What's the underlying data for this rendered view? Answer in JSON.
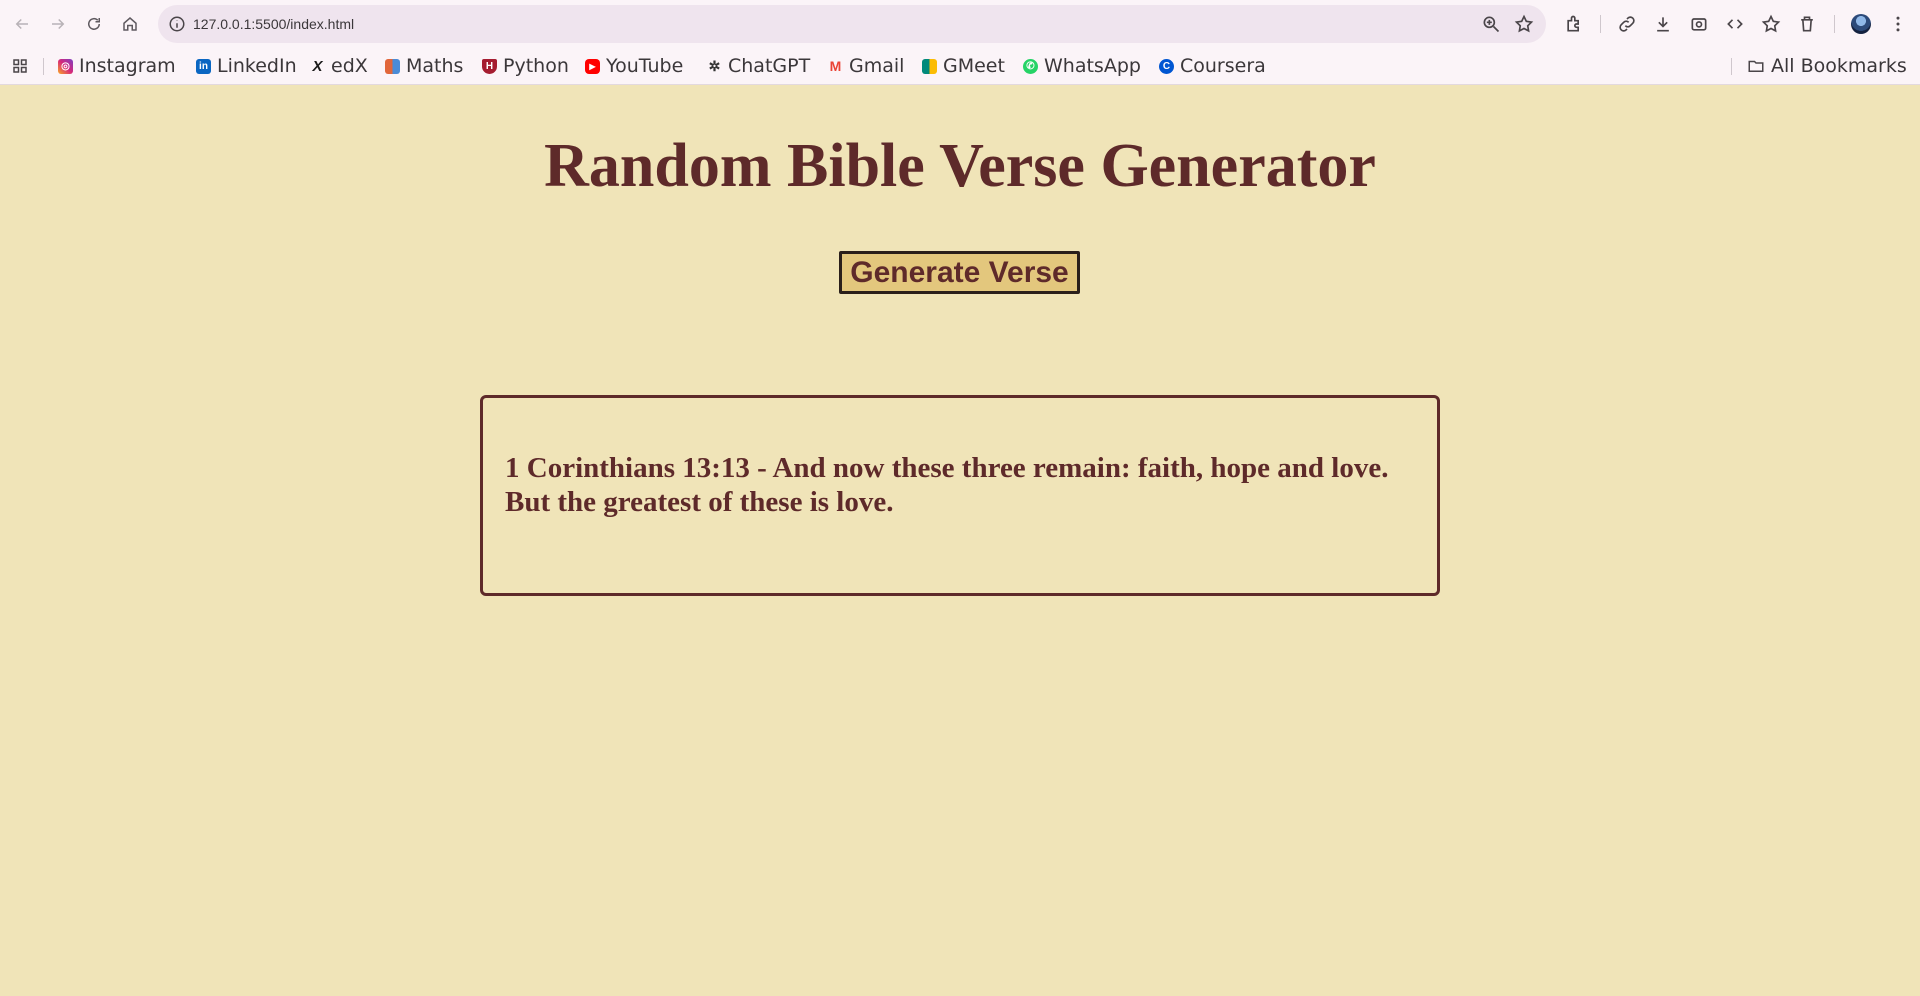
{
  "browser": {
    "url": "127.0.0.1:5500/index.html"
  },
  "bookmarks": {
    "items": [
      {
        "label": "Instagram",
        "icon": "instagram-icon",
        "color": "#d6287a"
      },
      {
        "label": "LinkedIn",
        "icon": "linkedin-icon",
        "color": "#0a66c2"
      },
      {
        "label": "edX",
        "icon": "edx-icon",
        "color": "#1a1a1a"
      },
      {
        "label": "Maths",
        "icon": "maths-icon",
        "color": "#e1663a"
      },
      {
        "label": "Python",
        "icon": "python-icon",
        "color": "#a51c30"
      },
      {
        "label": "YouTube",
        "icon": "youtube-icon",
        "color": "#ff0000"
      },
      {
        "label": "ChatGPT",
        "icon": "chatgpt-icon",
        "color": "#333333"
      },
      {
        "label": "Gmail",
        "icon": "gmail-icon",
        "color": "#ea4335"
      },
      {
        "label": "GMeet",
        "icon": "gmeet-icon",
        "color": "#00897b"
      },
      {
        "label": "WhatsApp",
        "icon": "whatsapp-icon",
        "color": "#25d366"
      },
      {
        "label": "Coursera",
        "icon": "coursera-icon",
        "color": "#0056d2"
      }
    ],
    "all_label": "All Bookmarks"
  },
  "page": {
    "title": "Random Bible Verse Generator",
    "button_label": "Generate Verse",
    "verse": "1 Corinthians 13:13 - And now these three remain: faith, hope and love. But the greatest of these is love."
  },
  "colors": {
    "background": "#f0e4b8",
    "accent": "#5e2a2a",
    "button": "#e3c77d"
  }
}
